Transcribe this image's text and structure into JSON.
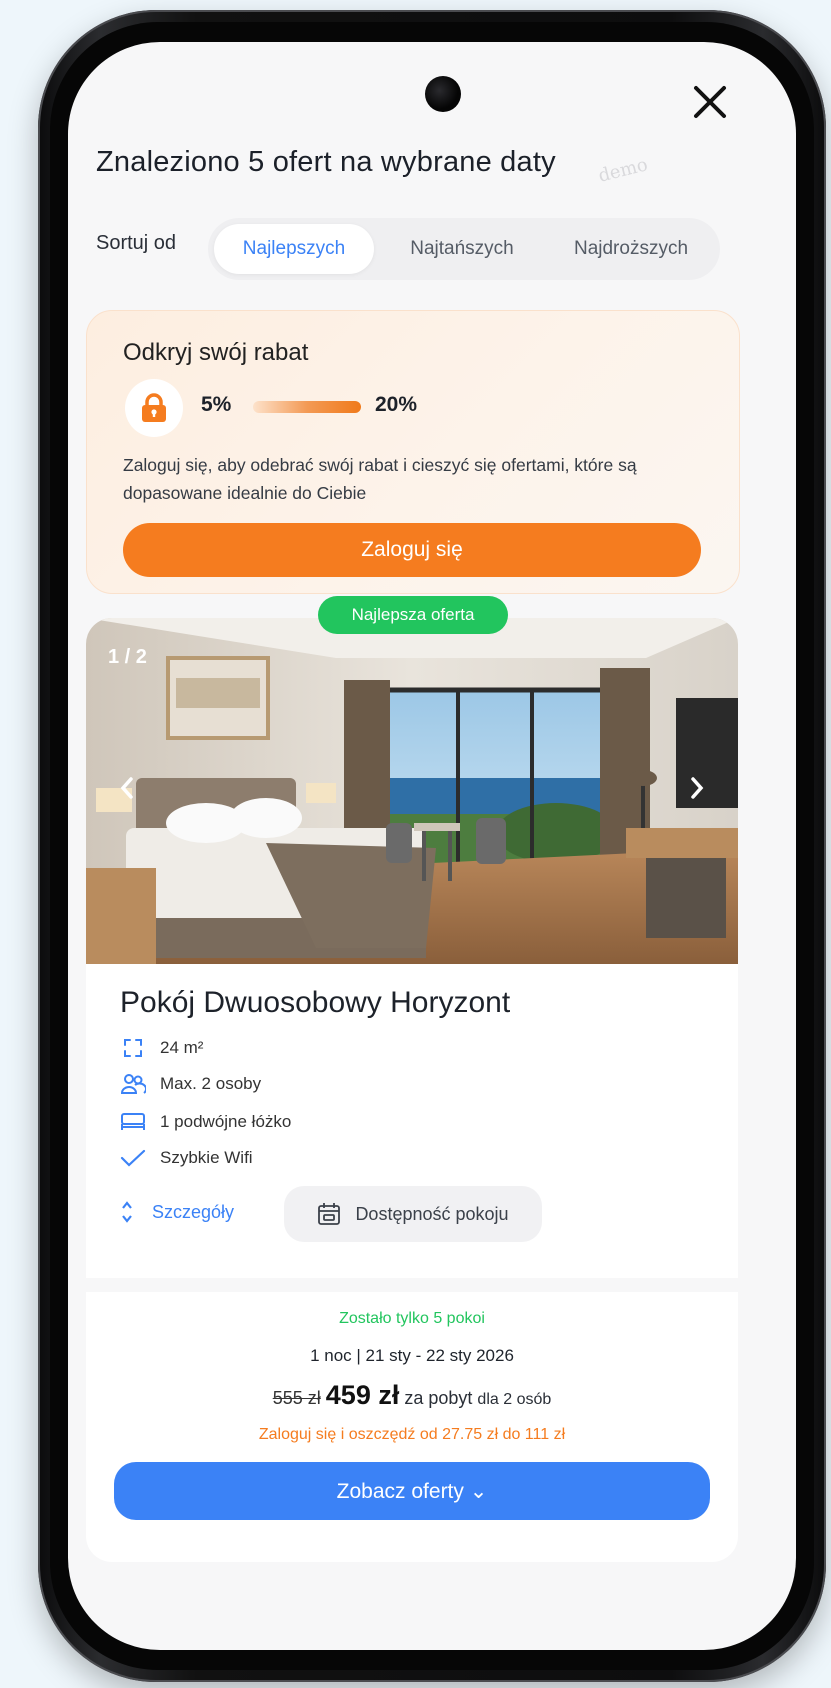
{
  "header": {
    "title": "Znaleziono 5 ofert na wybrane daty",
    "watermark": "demo"
  },
  "sort": {
    "label": "Sortuj od",
    "options": [
      "Najlepszych",
      "Najtańszych",
      "Najdroższych"
    ],
    "selected": "Najlepszych"
  },
  "promo": {
    "title": "Odkryj swój rabat",
    "min_discount": "5%",
    "max_discount": "20%",
    "text": "Zaloguj się, aby odebrać swój rabat i cieszyć się ofertami, które są dopasowane idealnie do Ciebie",
    "button": "Zaloguj się"
  },
  "offer": {
    "badge": "Najlepsza oferta",
    "image_counter": "1 / 2",
    "name": "Pokój Dwuosobowy Horyzont",
    "features": [
      {
        "icon": "area-icon",
        "text": "24 m²"
      },
      {
        "icon": "people-icon",
        "text": "Max. 2 osoby"
      },
      {
        "icon": "bed-icon",
        "text": "1 podwójne łóżko"
      },
      {
        "icon": "check-icon",
        "text": "Szybkie Wifi"
      }
    ],
    "details_label": "Szczegóły",
    "availability_label": "Dostępność pokoju",
    "rooms_left": "Zostało tylko 5 pokoi",
    "dates": "1 noc | 21 sty - 22 sty 2026",
    "old_price": "555 zł",
    "new_price": "459 zł",
    "price_suffix": "za pobyt",
    "guests": "dla 2 osób",
    "login_saving": "Zaloguj się i oszczędź od 27.75 zł do 111 zł",
    "offers_button": "Zobacz oferty ⌄"
  },
  "colors": {
    "accent_blue": "#3b82f6",
    "accent_orange": "#f57c1f",
    "badge_green": "#22c55e"
  }
}
